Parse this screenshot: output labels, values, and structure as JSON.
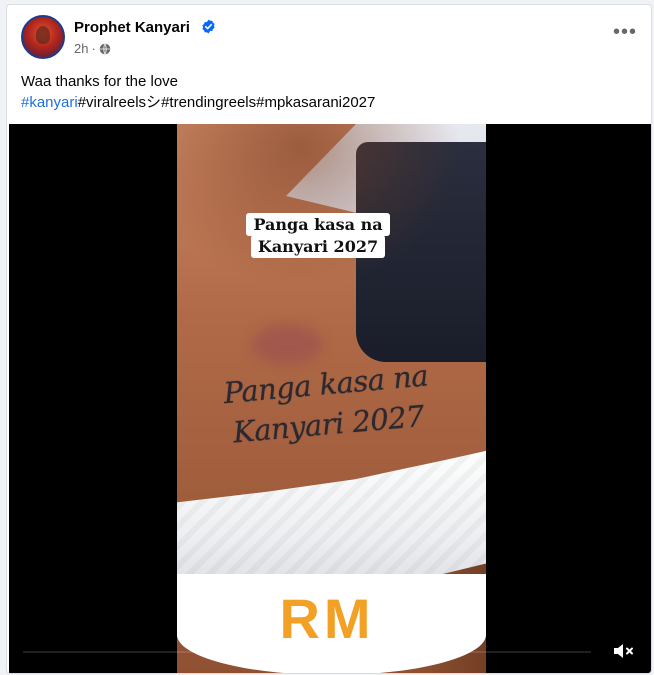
{
  "post": {
    "author": "Prophet Kanyari",
    "time": "2h",
    "separator": "·",
    "menu_glyph": "•••",
    "caption": "Waa thanks for the love",
    "hashtags": [
      "#kanyari",
      "#viralreelsシ",
      "#trendingreels",
      "#mpkasarani2027"
    ]
  },
  "video": {
    "overlay_text": "Panga kasa na Kanyari 2027",
    "tattoo_line1": "Panga kasa na",
    "tattoo_line2": "Kanyari 2027",
    "shirt_print": "RM",
    "muted": true
  },
  "colors": {
    "link_blue": "#216fdb",
    "verified_blue": "#0866ff",
    "meta_gray": "#65676b"
  },
  "icons": {
    "verified": "verified-badge-icon",
    "privacy": "globe-icon",
    "more": "more-options-icon",
    "volume": "volume-muted-icon"
  }
}
